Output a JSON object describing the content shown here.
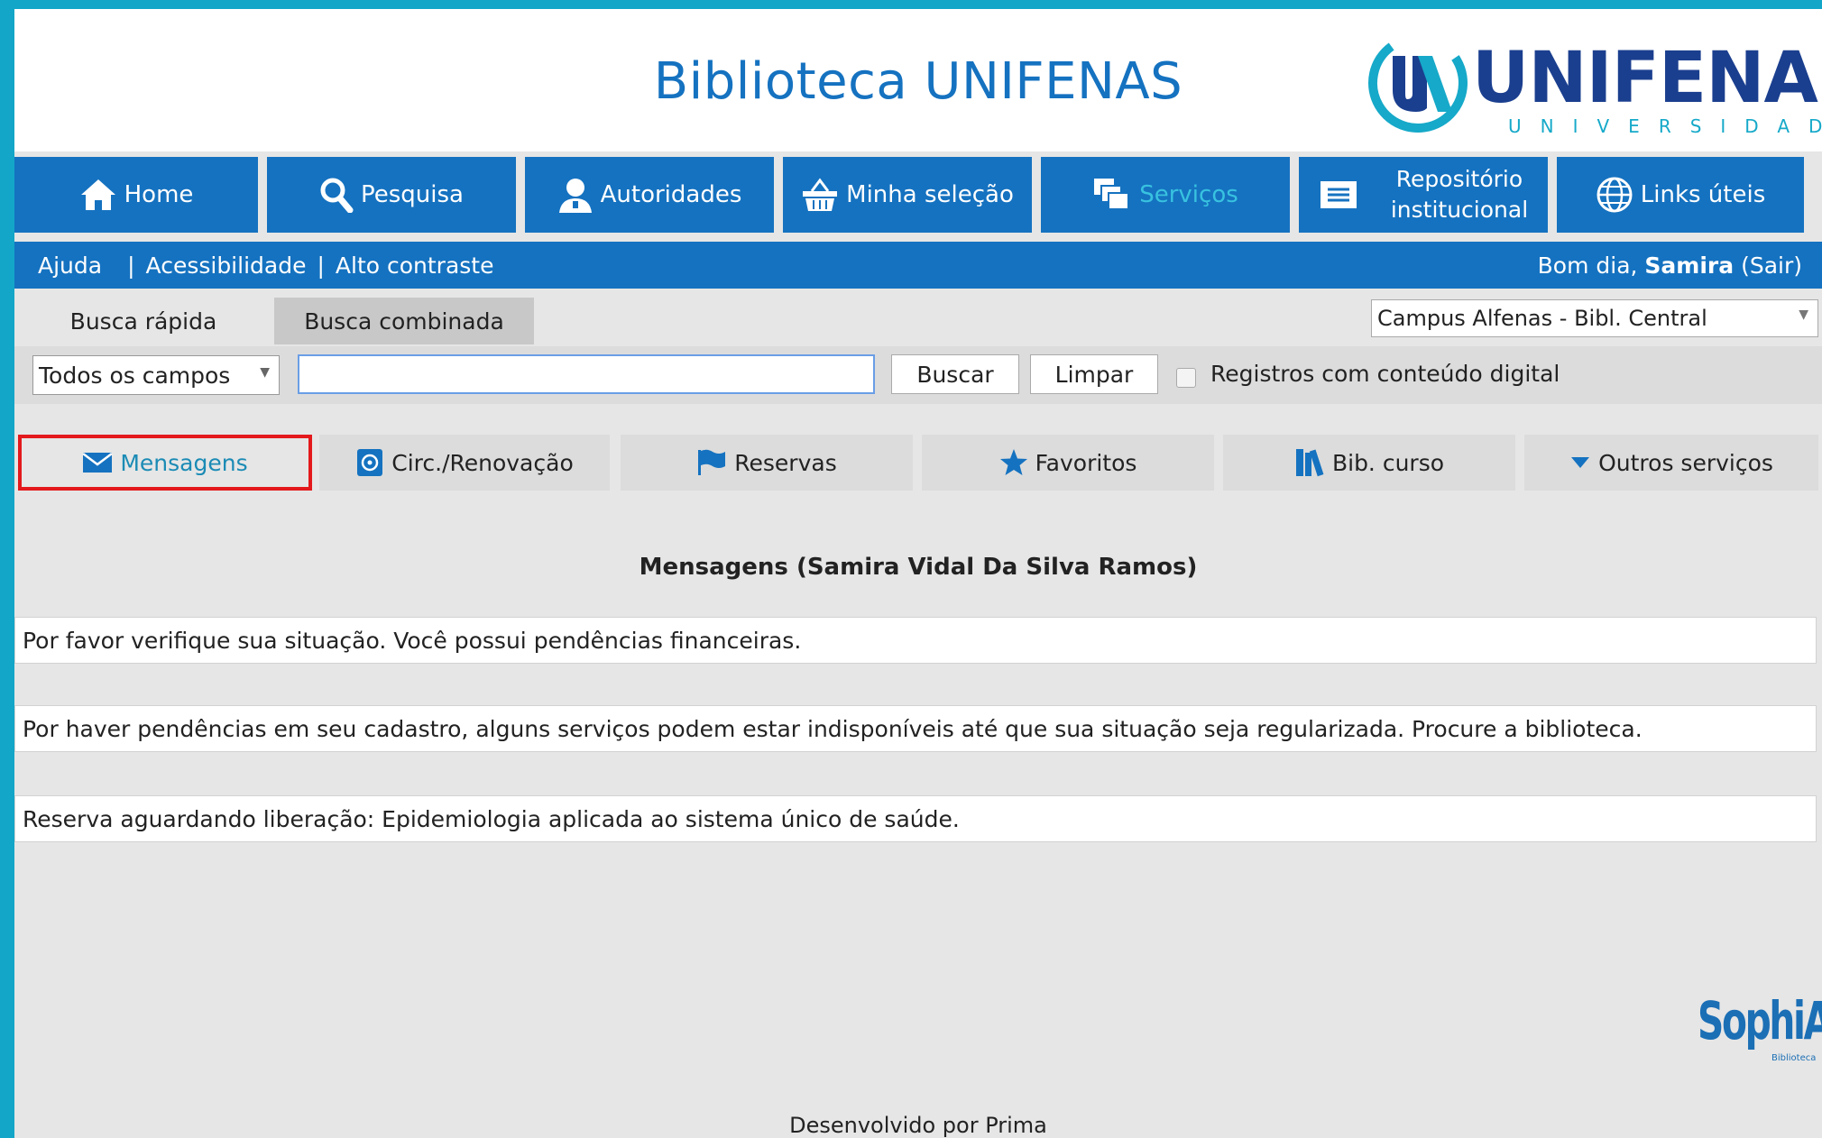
{
  "header": {
    "title": "Biblioteca UNIFENAS",
    "logo_word": "UNIFENAS",
    "logo_sub": "UNIVERSIDADE"
  },
  "main_nav": [
    {
      "label": "Home",
      "icon": "home-icon"
    },
    {
      "label": "Pesquisa",
      "icon": "search-icon"
    },
    {
      "label": "Autoridades",
      "icon": "person-icon"
    },
    {
      "label": "Minha seleção",
      "icon": "basket-icon"
    },
    {
      "label": "Serviços",
      "icon": "services-icon",
      "active": true
    },
    {
      "label_line1": "Repositório",
      "label_line2": "institucional",
      "icon": "repository-icon"
    },
    {
      "label": "Links úteis",
      "icon": "globe-icon"
    }
  ],
  "sub_nav": {
    "help": "Ajuda",
    "sep": "|",
    "accessibility": "Acessibilidade",
    "high_contrast": "Alto contraste",
    "greeting_prefix": "Bom dia,",
    "user_name": "Samira",
    "logout": "(Sair)"
  },
  "search": {
    "tab_quick": "Busca rápida",
    "tab_combined": "Busca combinada",
    "campus": "Campus Alfenas - Bibl. Central",
    "field": "Todos os campos",
    "query": "",
    "search_button": "Buscar",
    "clear_button": "Limpar",
    "digital_only_label": "Registros com conteúdo digital",
    "digital_only_checked": false
  },
  "services": [
    {
      "label": "Mensagens",
      "icon": "envelope-icon",
      "active": true
    },
    {
      "label": "Circ./Renovação",
      "icon": "circulation-icon"
    },
    {
      "label": "Reservas",
      "icon": "flag-icon"
    },
    {
      "label": "Favoritos",
      "icon": "star-icon"
    },
    {
      "label": "Bib. curso",
      "icon": "books-icon"
    },
    {
      "label": "Outros serviços",
      "icon": "caret-down-icon"
    }
  ],
  "messages": {
    "title": "Mensagens (Samira Vidal Da Silva Ramos)",
    "items": [
      "Por favor verifique sua situação. Você possui pendências financeiras.",
      "Por haver pendências em seu cadastro, alguns serviços podem estar indisponíveis até que sua situação seja regularizada. Procure a biblioteca.",
      "Reserva aguardando liberação: Epidemiologia aplicada ao sistema único de saúde."
    ]
  },
  "brand": {
    "sophia": "SophiA",
    "sophia_sub": "Biblioteca"
  },
  "footer": "Desenvolvido por Prima",
  "colors": {
    "primary": "#1572c0",
    "frame": "#13a6c8",
    "highlight": "#e3191c",
    "active_text": "#38c2e0"
  }
}
